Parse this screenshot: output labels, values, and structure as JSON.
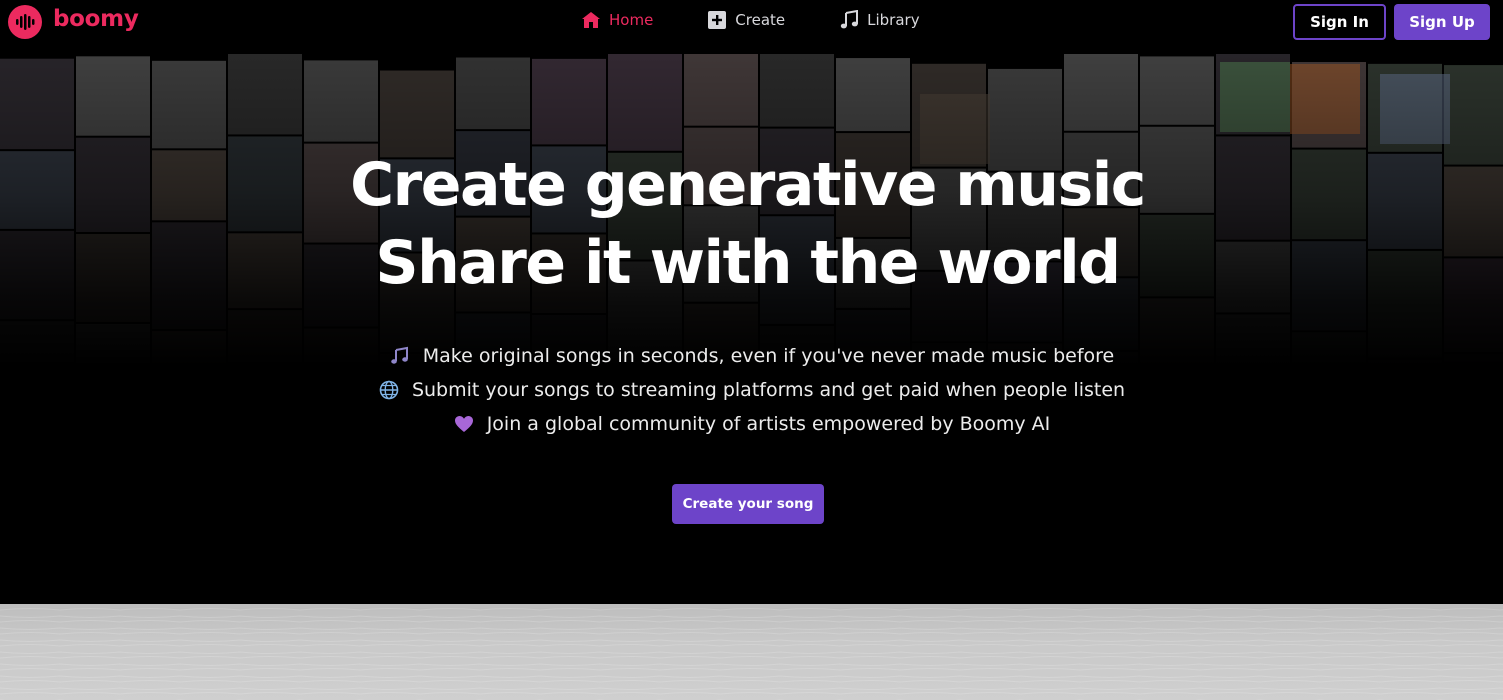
{
  "brand": {
    "name": "boomy",
    "accent": "#ec2a5f",
    "purple": "#6d44c9"
  },
  "nav": {
    "links": [
      {
        "label": "Home",
        "icon": "home-icon",
        "active": true
      },
      {
        "label": "Create",
        "icon": "plus-square-icon",
        "active": false
      },
      {
        "label": "Library",
        "icon": "music-note-icon",
        "active": false
      }
    ],
    "sign_in": "Sign In",
    "sign_up": "Sign Up"
  },
  "hero": {
    "headline_1": "Create generative music",
    "headline_2": "Share it with the world",
    "bullets": [
      {
        "icon": "musical-notes-icon",
        "text": "Make original songs in seconds, even if you've never made music before"
      },
      {
        "icon": "globe-icon",
        "text": "Submit your songs to streaming platforms and get paid when people listen"
      },
      {
        "icon": "purple-heart-icon",
        "text": "Join a global community of artists empowered by Boomy AI"
      }
    ],
    "cta": "Create your song"
  }
}
